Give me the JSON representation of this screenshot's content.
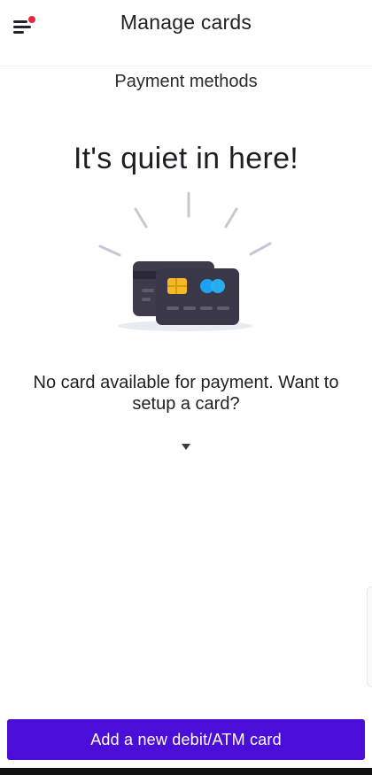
{
  "header": {
    "title": "Manage cards",
    "menu_icon": "hamburger-menu-icon",
    "notification_color": "#e02a3b"
  },
  "section": {
    "title": "Payment methods"
  },
  "empty_state": {
    "heading": "It's quiet in here!",
    "illustration": "credit-cards-icon",
    "message": "No card available for payment. Want to setup a card?",
    "expand_icon": "chevron-down-icon"
  },
  "cta": {
    "label": "Add a new debit/ATM card",
    "color": "#4a0ed8"
  }
}
